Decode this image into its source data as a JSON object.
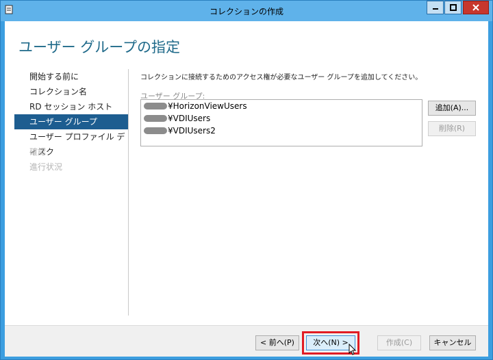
{
  "window": {
    "title": "コレクションの作成"
  },
  "page": {
    "heading": "ユーザー グループの指定"
  },
  "sidebar": {
    "items": [
      {
        "label": "開始する前に",
        "state": "normal"
      },
      {
        "label": "コレクション名",
        "state": "normal"
      },
      {
        "label": "RD セッション ホスト",
        "state": "normal"
      },
      {
        "label": "ユーザー グループ",
        "state": "active"
      },
      {
        "label": "ユーザー プロファイル ディスク",
        "state": "normal"
      },
      {
        "label": "確認",
        "state": "disabled"
      },
      {
        "label": "進行状況",
        "state": "disabled"
      }
    ]
  },
  "content": {
    "instruction": "コレクションに接続するためのアクセス権が必要なユーザー グループを追加してください。",
    "group_label": "ユーザー グループ:",
    "groups": [
      "¥HorizonViewUsers",
      "¥VDIUsers",
      "¥VDIUsers2"
    ],
    "add_label": "追加(A)...",
    "remove_label": "削除(R)"
  },
  "footer": {
    "prev_label": "< 前へ(P)",
    "next_label": "次へ(N) >",
    "create_label": "作成(C)",
    "cancel_label": "キャンセル"
  },
  "colors": {
    "frame": "#3c9ee0",
    "active_nav": "#1d5d90",
    "heading": "#1f6a8a",
    "highlight": "#e11c24",
    "close_button": "#c7372d"
  }
}
